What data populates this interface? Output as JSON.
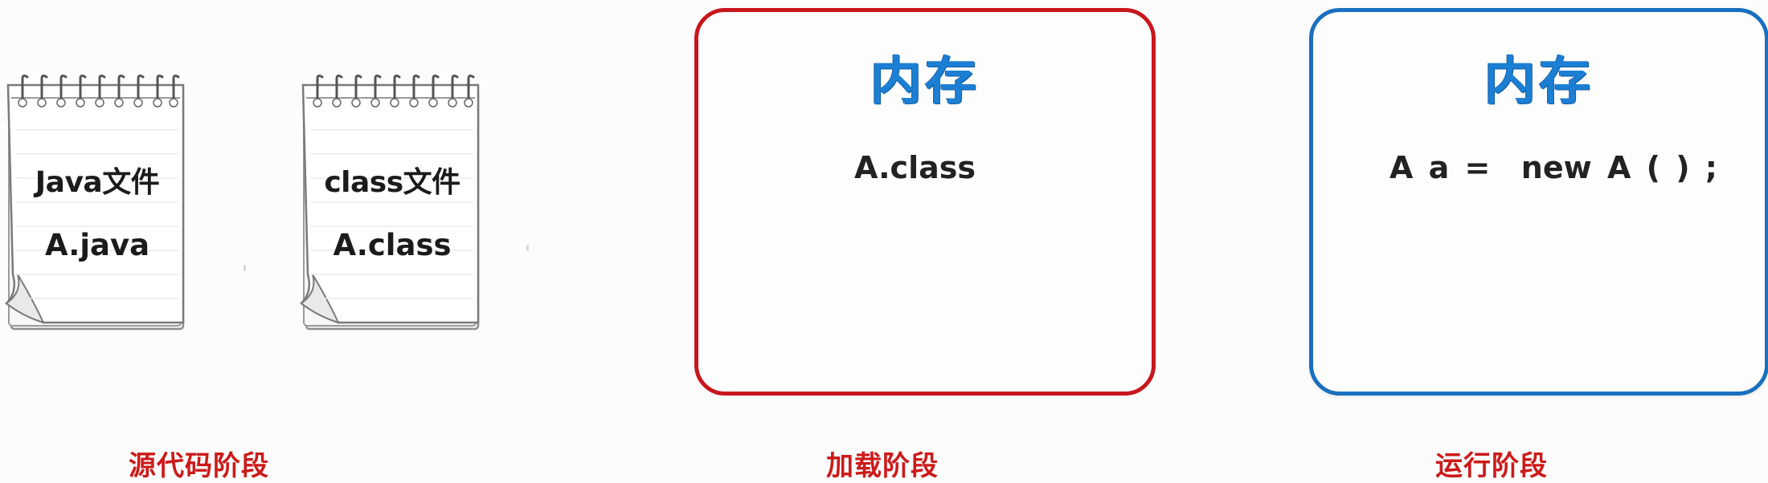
{
  "notepads": [
    {
      "title": "Java文件",
      "file": "A.java"
    },
    {
      "title": "class文件",
      "file": "A.class"
    }
  ],
  "memory_boxes": [
    {
      "title": "内存",
      "content": "A.class",
      "border_color": "#c8161d"
    },
    {
      "title": "内存",
      "content": "A a =  new A ( ) ;",
      "border_color": "#1a6fbf"
    }
  ],
  "stages": {
    "source": "源代码阶段",
    "load": "加载阶段",
    "run": "运行阶段"
  },
  "colors": {
    "stage_label": "#cc1a1a",
    "memory_title": "#1c7fd3",
    "text": "#222222"
  }
}
